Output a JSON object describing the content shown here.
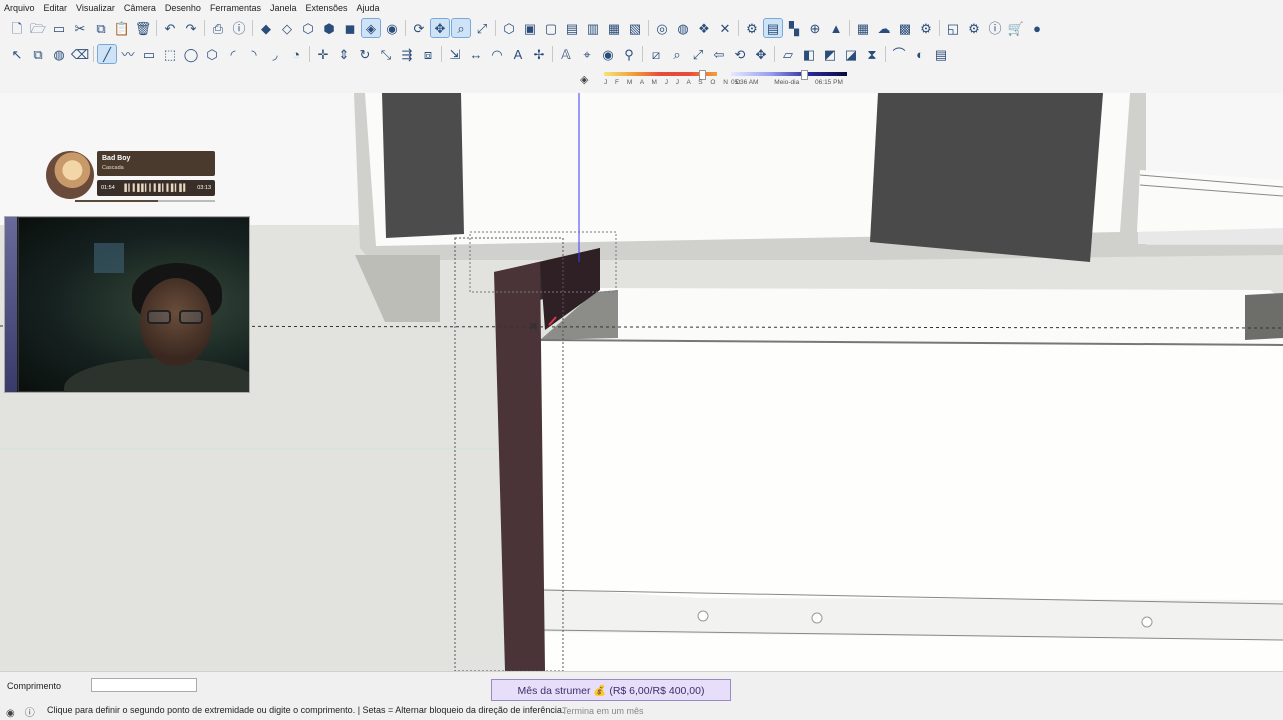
{
  "menu": [
    "Arquivo",
    "Editar",
    "Visualizar",
    "Câmera",
    "Desenho",
    "Ferramentas",
    "Janela",
    "Extensões",
    "Ajuda"
  ],
  "shadow": {
    "months": "J F M A M J J A S O N D",
    "times": [
      "05:36 AM",
      "Meio-dia",
      "06:15 PM"
    ]
  },
  "player": {
    "song": "Bad Boy",
    "artist": "Cascada",
    "elapsed": "01:54",
    "total": "03:13",
    "progress": 0.59
  },
  "statusbar": {
    "vcb_label": "Comprimento",
    "vcb_value": "",
    "hint": "Clique para definir o segundo ponto de extremidade ou digite o comprimento. | Setas = Alternar bloqueio da direção de inferência.",
    "goal_text": "Mês da strumer 💰 (R$ 6,00/R$ 400,00)",
    "goal_sub": "Termina em um mês"
  },
  "icons": {
    "toolbar1": [
      "new-icon",
      "open-icon",
      "save-icon",
      "cut-icon",
      "copy-icon",
      "paste-icon",
      "erase-icon",
      "undo-icon",
      "redo-icon",
      "print-icon",
      "model-info-icon",
      "xray-icon",
      "backedges-icon",
      "wireframe-icon",
      "hiddenline-icon",
      "shaded-icon",
      "shaded-textures-icon",
      "monochrome-icon",
      "orbit-icon",
      "pan-icon",
      "zoom-icon",
      "zoom-extents-icon",
      "iso-view-icon",
      "top-view-icon",
      "front-view-icon",
      "right-view-icon",
      "back-view-icon",
      "left-view-icon",
      "bottom-view-icon",
      "section-plane-icon",
      "display-section-icon",
      "section-cuts-icon",
      "section-fill-icon",
      "component-icon",
      "outliner-icon",
      "group-icon",
      "add-location-icon",
      "terrain-icon",
      "photo-textures-icon",
      "3d-warehouse-icon",
      "share-model-icon",
      "extension-warehouse-icon",
      "layout-icon",
      "extension-manager-icon",
      "info-icon",
      "shop-icon",
      "account-icon"
    ],
    "toolbar2": [
      "select-icon",
      "make-component-icon",
      "paint-bucket-icon",
      "eraser-icon",
      "line-icon",
      "freehand-icon",
      "rectangle-icon",
      "rotated-rectangle-icon",
      "circle-icon",
      "polygon-icon",
      "arc-icon",
      "2pt-arc-icon",
      "3pt-arc-icon",
      "pie-icon",
      "move-icon",
      "push-pull-icon",
      "rotate-icon",
      "scale-icon",
      "follow-me-icon",
      "offset-icon",
      "tape-measure-icon",
      "dimension-icon",
      "protractor-icon",
      "text-icon",
      "axes-icon",
      "3d-text-icon",
      "position-camera-icon",
      "look-around-icon",
      "walk-icon",
      "section-icon",
      "zoom-window-icon",
      "zoom-extents2-icon",
      "previous-view-icon",
      "orbit2-icon",
      "pan2-icon",
      "sandbox-icon",
      "solid-tools-icon",
      "outer-shell-icon",
      "intersect-icon",
      "mirror-icon",
      "curve-icon",
      "dynamic-components-icon",
      "scenes-icon"
    ]
  }
}
